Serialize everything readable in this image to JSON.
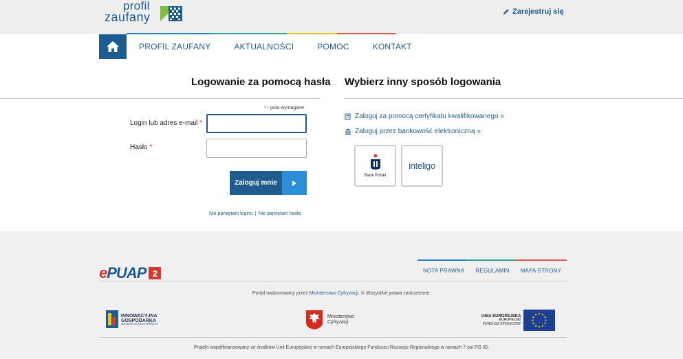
{
  "header": {
    "logo_line1": "profil",
    "logo_line2": "zaufany",
    "register_label": "Zarejestruj się"
  },
  "colors": {
    "brand_blue": "#1e5b8f",
    "accent_blue": "#2b8ed6",
    "line_blue": "#2a80c8",
    "line_teal": "#2aa59a",
    "line_yellow": "#e6c619",
    "line_red": "#e05a4c",
    "required_red": "#dd2222"
  },
  "nav": {
    "items": [
      {
        "label": "PROFIL ZAUFANY"
      },
      {
        "label": "AKTUALNOŚCI"
      },
      {
        "label": "POMOC"
      },
      {
        "label": "KONTAKT"
      }
    ]
  },
  "login": {
    "title": "Logowanie za pomocą hasła",
    "required_star": "*",
    "required_note": " - pola wymagane",
    "login_label": "Login lub adres e-mail",
    "login_value": "",
    "password_label": "Hasło",
    "password_value": "",
    "submit_label": "Zaloguj mnie",
    "forgot_login": "Nie pamiętam loginu",
    "separator": "|",
    "forgot_password": "Nie pamiętam hasła"
  },
  "alt": {
    "title": "Wybierz inny sposób logowania",
    "cert_link": "Zaloguj za pomocą certyfikatu kwalifikowanego »",
    "bank_link": "Zaloguj przez bankowość elektroniczną »",
    "banks": [
      {
        "name": "Bank Polski"
      },
      {
        "name": "inteligo"
      }
    ]
  },
  "footer": {
    "epuap_e": "e",
    "epuap_text": "PUAP",
    "epuap_num": "2",
    "links": [
      "NOTA PRAWNA",
      "REGULAMIN",
      "MAPA STRONY"
    ],
    "portal_pre": "Portal nadzorowany przez ",
    "portal_link": "Ministerstwo Cyfryzacji",
    "portal_post": ". © Wszystkie prawa zastrzeżone.",
    "ig_line1": "INNOWACYJNA",
    "ig_line2": "GOSPODARKA",
    "ig_line3": "NARODOWA STRATEGIA SPÓJNOŚCI",
    "min_line1": "Ministerstwo",
    "min_line2": "Cyfryzacji",
    "ue_line1": "UNIA EUROPEJSKA",
    "ue_line2": "EUROPEJSKI",
    "ue_line3": "FUNDUSZ SPOŁECZNY",
    "project": "Projekt współfinansowany ze środków Unii Europejskiej w ramach Europejskiego Funduszu Rozwoju Regionalnego w ramach 7 osi PO IG."
  }
}
